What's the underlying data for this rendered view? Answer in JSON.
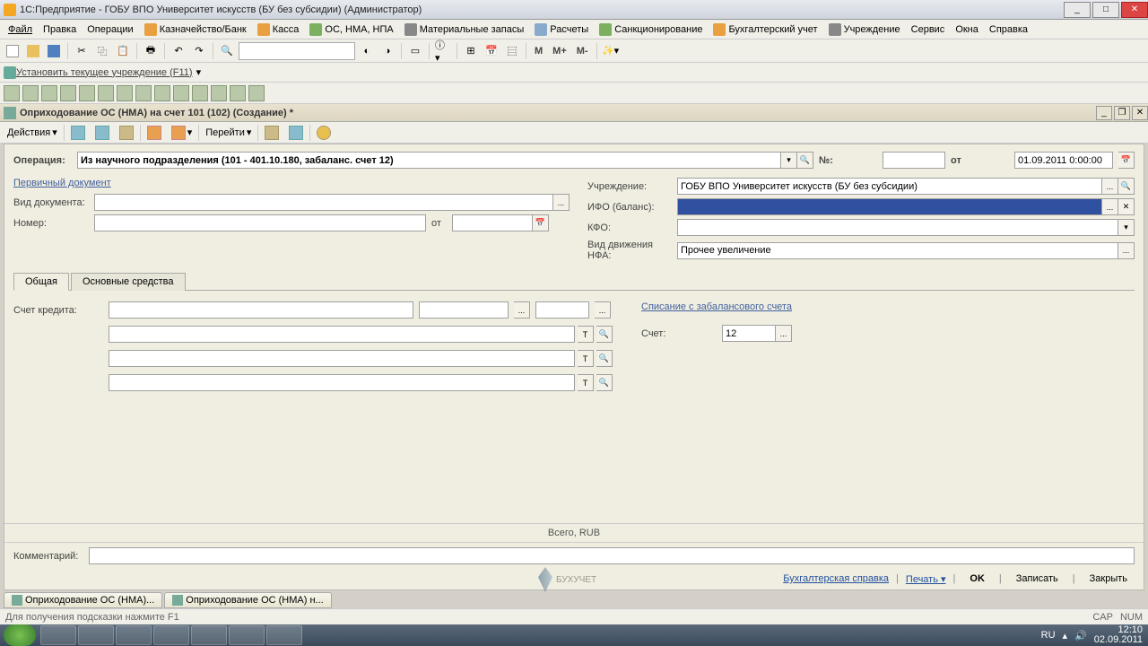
{
  "titlebar": {
    "text": "1С:Предприятие - ГОБУ ВПО Университет искусств (БУ без субсидии) (Администратор)"
  },
  "menu": {
    "file": "Файл",
    "edit": "Правка",
    "operations": "Операции",
    "treasury": "Казначейство/Банк",
    "cash": "Касса",
    "os": "ОС, НМА, НПА",
    "materials": "Материальные запасы",
    "calc": "Расчеты",
    "sanction": "Санкционирование",
    "accounting": "Бухгалтерский учет",
    "institution": "Учреждение",
    "service": "Сервис",
    "windows": "Окна",
    "help": "Справка"
  },
  "sub": {
    "setcurrent": "Установить текущее учреждение (F11)"
  },
  "toolbar2": {
    "m": "М",
    "mplus": "М+",
    "mminus": "М-"
  },
  "dochdr": {
    "title": "Оприходование ОС (НМА) на счет 101 (102) (Создание) *"
  },
  "doctb": {
    "actions": "Действия",
    "goto": "Перейти"
  },
  "form": {
    "operation_label": "Операция:",
    "operation_value": "Из научного подразделения (101 - 401.10.180, забаланс. счет 12)",
    "number_label": "№:",
    "number_value": "",
    "from_label": "от",
    "date_value": "01.09.2011 0:00:00",
    "primary_doc": "Первичный документ",
    "doctype_label": "Вид документа:",
    "doctype_value": "",
    "docnum_label": "Номер:",
    "docnum_value": "",
    "docnum_from": "от",
    "institution_label": "Учреждение:",
    "institution_value": "ГОБУ ВПО Университет искусств (БУ без субсидии)",
    "ifo_label": "ИФО (баланс):",
    "ifo_value": "",
    "kfo_label": "КФО:",
    "kfo_value": "",
    "nfa_label": "Вид движения НФА:",
    "nfa_value": "Прочее увеличение",
    "tab_general": "Общая",
    "tab_os": "Основные средства",
    "credit_label": "Счет кредита:",
    "writeoff_title": "Списание с забалансового счета",
    "account_label": "Счет:",
    "account_value": "12",
    "total": "Всего, RUB",
    "comment_label": "Комментарий:",
    "comment_value": "",
    "accref": "Бухгалтерская справка",
    "print": "Печать",
    "ok": "OK",
    "save": "Записать",
    "close": "Закрыть"
  },
  "tasktabs": {
    "t1": "Оприходование ОС (НМА)...",
    "t2": "Оприходование ОС (НМА) н..."
  },
  "status": {
    "hint": "Для получения подсказки нажмите F1",
    "cap": "CAP",
    "num": "NUM"
  },
  "taskbar": {
    "lang": "RU",
    "time": "12:10",
    "date": "02.09.2011"
  },
  "watermark": "БУХУЧЕТ"
}
